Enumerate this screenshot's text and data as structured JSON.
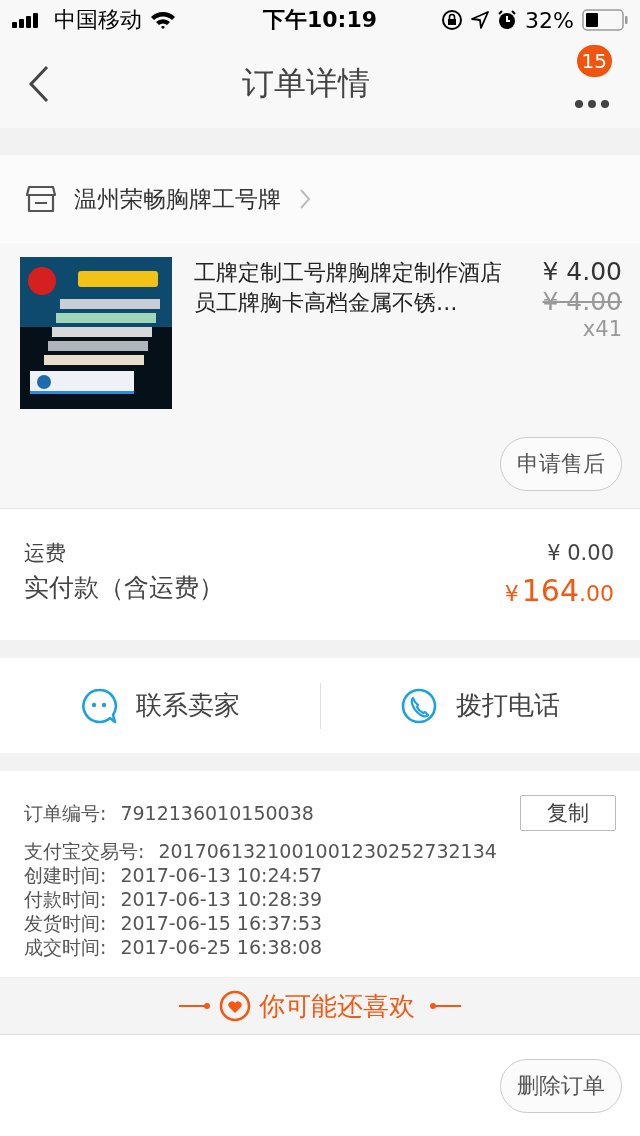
{
  "status_bar": {
    "carrier": "中国移动",
    "time": "下午10:19",
    "battery": "32%"
  },
  "nav": {
    "title": "订单详情",
    "badge": "15"
  },
  "shop": {
    "name": "温州荣畅胸牌工号牌"
  },
  "product": {
    "title": "工牌定制工号牌胸牌定制作酒店员工牌胸卡高档金属不锈…",
    "price": "¥ 4.00",
    "original_price": "¥ 4.00",
    "quantity": "x41",
    "after_sale_button": "申请售后"
  },
  "totals": {
    "shipping_label": "运费",
    "shipping_value": "¥ 0.00",
    "paid_label": "实付款（含运费）",
    "paid_currency": "¥",
    "paid_integer": "164",
    "paid_decimal": ".00"
  },
  "contact": [
    {
      "kind": "chat",
      "label": "联系卖家"
    },
    {
      "kind": "phone",
      "label": "拨打电话"
    }
  ],
  "order_info": {
    "copy_button": "复制",
    "rows": [
      {
        "label": "订单编号:",
        "value": "7912136010150038"
      },
      {
        "label": "支付宝交易号:",
        "value": "2017061321001001230252732134"
      },
      {
        "label": "创建时间:",
        "value": "2017-06-13 10:24:57"
      },
      {
        "label": "付款时间:",
        "value": "2017-06-13 10:28:39"
      },
      {
        "label": "发货时间:",
        "value": "2017-06-15 16:37:53"
      },
      {
        "label": "成交时间:",
        "value": "2017-06-25 16:38:08"
      }
    ]
  },
  "recommend": {
    "title": "你可能还喜欢"
  },
  "footer": {
    "delete_button": "删除订单"
  }
}
